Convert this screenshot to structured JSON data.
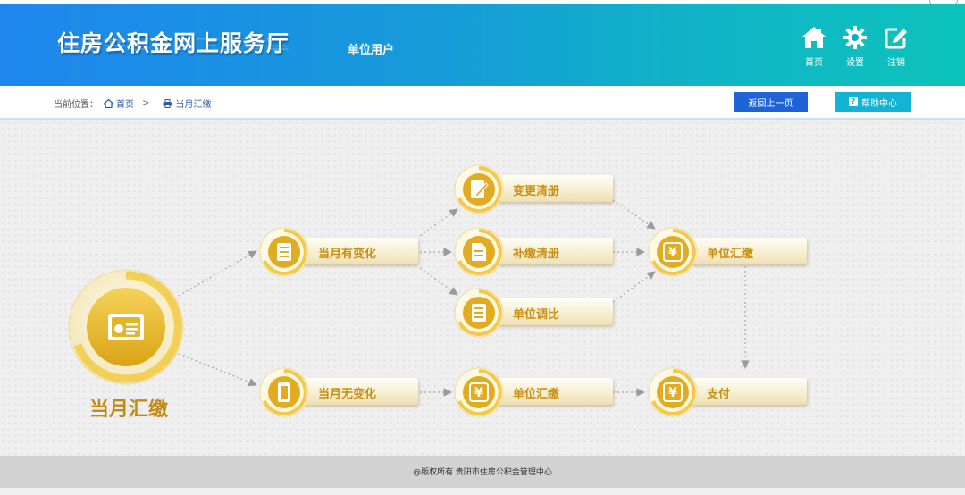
{
  "header": {
    "title": "住房公积金网上服务厅",
    "user_type": "单位用户",
    "nav": [
      {
        "label": "首页",
        "icon": "home-icon"
      },
      {
        "label": "设置",
        "icon": "gear-icon"
      },
      {
        "label": "注销",
        "icon": "logout-edit-icon"
      }
    ]
  },
  "breadcrumb": {
    "prefix": "当前位置：",
    "home": "首页",
    "separator": ">",
    "current": "当月汇缴"
  },
  "buttons": {
    "back": "返回上一页",
    "help_icon": "?",
    "help": "帮助中心"
  },
  "flow": {
    "root": {
      "label": "当月汇缴",
      "icon": "payment-card-icon"
    },
    "nodes": [
      {
        "id": "changed",
        "label": "当月有变化",
        "icon": "document-icon"
      },
      {
        "id": "unchanged",
        "label": "当月无变化",
        "icon": "notebook-icon"
      },
      {
        "id": "change-list",
        "label": "变更清册",
        "icon": "edit-document-icon"
      },
      {
        "id": "supplement-list",
        "label": "补缴清册",
        "icon": "document-icon"
      },
      {
        "id": "ratio-adjust",
        "label": "单位调比",
        "icon": "document-icon"
      },
      {
        "id": "summary-pay-a",
        "label": "单位汇缴",
        "icon": "yen-icon"
      },
      {
        "id": "summary-pay-b",
        "label": "单位汇缴",
        "icon": "yen-icon"
      },
      {
        "id": "pay",
        "label": "支付",
        "icon": "yen-icon"
      }
    ]
  },
  "footer": {
    "copyright": "@版权所有 贵阳市住房公积金管理中心"
  },
  "colors": {
    "header_start": "#1f86ee",
    "header_end": "#0cc3bb",
    "accent_gold": "#c98f10",
    "back_button": "#1e64d6",
    "help_button": "#13b3d3"
  }
}
